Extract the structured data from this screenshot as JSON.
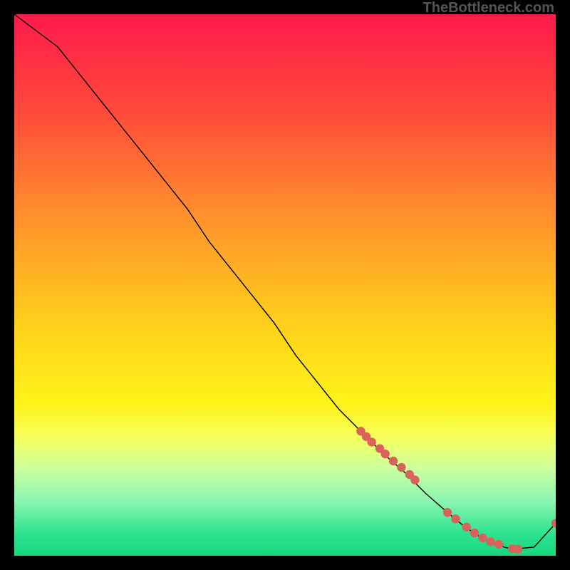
{
  "watermark": "TheBottleneck.com",
  "chart_data": {
    "type": "line",
    "title": "",
    "xlabel": "",
    "ylabel": "",
    "xlim": [
      0,
      100
    ],
    "ylim": [
      0,
      100
    ],
    "grid": false,
    "legend": false,
    "gradient_stops": [
      {
        "offset": 0,
        "color": "#ff1a4b"
      },
      {
        "offset": 18,
        "color": "#ff4a3a"
      },
      {
        "offset": 40,
        "color": "#ff9a2a"
      },
      {
        "offset": 58,
        "color": "#ffd21a"
      },
      {
        "offset": 72,
        "color": "#fff31a"
      },
      {
        "offset": 78,
        "color": "#f7ff5a"
      },
      {
        "offset": 84,
        "color": "#ccffa0"
      },
      {
        "offset": 90,
        "color": "#88f5b0"
      },
      {
        "offset": 96,
        "color": "#2de38f"
      },
      {
        "offset": 100,
        "color": "#17d67e"
      }
    ],
    "series": [
      {
        "name": "bottleneck-curve",
        "color": "#000000",
        "stroke_width": 1.4,
        "x": [
          0,
          4,
          8,
          12,
          16,
          20,
          24,
          28,
          32,
          36,
          40,
          44,
          48,
          52,
          56,
          60,
          64,
          68,
          72,
          76,
          80,
          83,
          86,
          89,
          92,
          96,
          100
        ],
        "y": [
          100,
          97,
          94,
          89,
          84,
          79,
          74,
          69,
          64,
          58,
          53,
          48,
          43,
          37,
          32,
          27,
          23,
          19,
          15.5,
          11.5,
          8,
          5.5,
          3.5,
          2,
          1.2,
          1.6,
          6
        ]
      }
    ],
    "markers": {
      "name": "highlight-points",
      "color": "#d9635b",
      "radius": 6.2,
      "x": [
        64,
        65,
        66,
        67.5,
        68.5,
        70,
        71.5,
        73,
        74,
        80,
        81.5,
        83.5,
        85,
        86.5,
        88,
        89.5,
        92,
        93,
        100
      ],
      "y": [
        23,
        22,
        21,
        19.8,
        18.8,
        17.5,
        16.3,
        15,
        14,
        8,
        6.8,
        5.3,
        4.2,
        3.3,
        2.6,
        2.1,
        1.3,
        1.2,
        6
      ]
    }
  }
}
